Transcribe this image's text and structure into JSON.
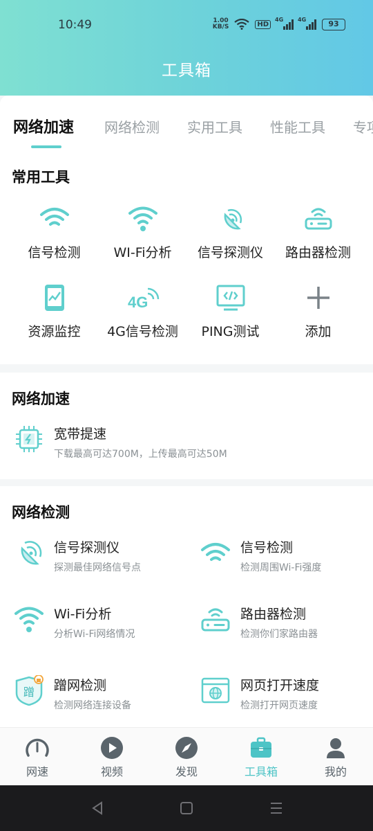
{
  "status_bar": {
    "time": "10:49",
    "net_speed_value": "1.00",
    "net_speed_unit": "KB/S",
    "hd": "HD",
    "sig1": "4G",
    "sig2": "4G",
    "battery": "93"
  },
  "header": {
    "title": "工具箱"
  },
  "tabs": [
    "网络加速",
    "网络检测",
    "实用工具",
    "性能工具",
    "专项"
  ],
  "common_tools": {
    "title": "常用工具",
    "items": [
      {
        "label": "信号检测",
        "icon": "wifi-icon"
      },
      {
        "label": "WI-Fi分析",
        "icon": "wifi-analyze-icon"
      },
      {
        "label": "信号探测仪",
        "icon": "radar-icon"
      },
      {
        "label": "路由器检测",
        "icon": "router-icon"
      },
      {
        "label": "资源监控",
        "icon": "tablet-monitor-icon"
      },
      {
        "label": "4G信号检测",
        "icon": "4g-signal-icon"
      },
      {
        "label": "PING测试",
        "icon": "code-monitor-icon"
      },
      {
        "label": "添加",
        "icon": "plus-icon"
      }
    ]
  },
  "acceleration": {
    "title": "网络加速",
    "item": {
      "title": "宽带提速",
      "subtitle": "下载最高可达700M，上传最高可达50M",
      "icon": "chip-icon"
    }
  },
  "detection": {
    "title": "网络检测",
    "items": [
      {
        "title": "信号探测仪",
        "subtitle": "探测最佳网络信号点",
        "icon": "radar-icon"
      },
      {
        "title": "信号检测",
        "subtitle": "检测周围Wi-Fi强度",
        "icon": "wifi-icon"
      },
      {
        "title": "Wi-Fi分析",
        "subtitle": "分析Wi-Fi网络情况",
        "icon": "wifi-analyze-icon"
      },
      {
        "title": "路由器检测",
        "subtitle": "检测你们家路由器",
        "icon": "router-icon"
      },
      {
        "title": "蹭网检测",
        "subtitle": "检测网络连接设备",
        "icon": "freeloader-shield-icon",
        "badge": "蹭"
      },
      {
        "title": "网页打开速度",
        "subtitle": "检测打开网页速度",
        "icon": "browser-globe-icon"
      }
    ]
  },
  "bottom_nav": [
    {
      "label": "网速",
      "icon": "speedometer-icon"
    },
    {
      "label": "视频",
      "icon": "play-icon"
    },
    {
      "label": "发现",
      "icon": "compass-icon"
    },
    {
      "label": "工具箱",
      "icon": "toolbox-icon",
      "active": true
    },
    {
      "label": "我的",
      "icon": "user-icon"
    }
  ],
  "colors": {
    "accent": "#4dc4c6",
    "header_start": "#7fe0d2",
    "header_end": "#62c8e6"
  }
}
